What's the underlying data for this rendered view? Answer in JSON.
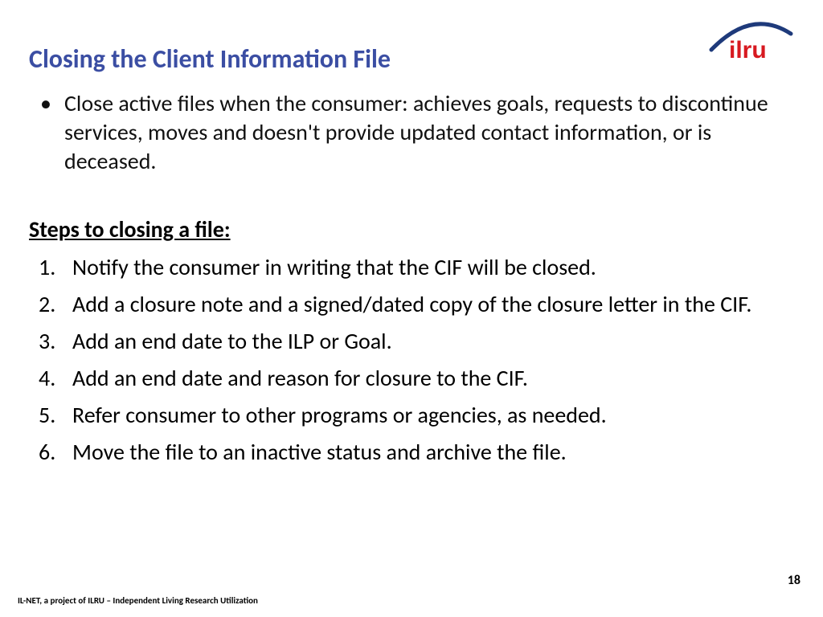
{
  "title": "Closing the Client Information File",
  "bullets": [
    "Close active files when the consumer: achieves goals, requests to discontinue services, moves and doesn't provide updated contact information, or is deceased."
  ],
  "steps_heading": "Steps to closing a file:",
  "steps": [
    "Notify the consumer in writing that the CIF will be closed.",
    "Add a closure note and a signed/dated copy of the closure letter in the CIF.",
    "Add an end date to the ILP or Goal.",
    "Add an end date and reason for closure to the CIF.",
    "Refer consumer to other programs or agencies, as needed.",
    "Move the file to an inactive status and archive the file."
  ],
  "footer": "IL-NET, a project of ILRU – Independent Living Research Utilization",
  "page_number": "18",
  "logo": {
    "text": "ilru",
    "color": "#d71920",
    "swoosh_color": "#1e3a7b"
  }
}
